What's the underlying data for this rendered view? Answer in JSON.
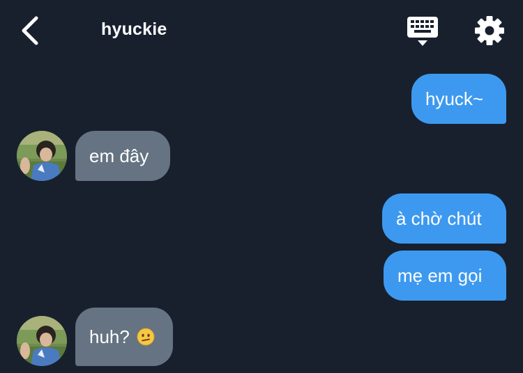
{
  "header": {
    "title": "hyuckie",
    "back_icon": "chevron-left-icon",
    "keyboard_icon": "keyboard-icon",
    "settings_icon": "gear-icon"
  },
  "messages": [
    {
      "direction": "outgoing",
      "text": "hyuck~"
    },
    {
      "direction": "incoming",
      "text": "em đây"
    },
    {
      "direction": "outgoing",
      "text": "à chờ chút"
    },
    {
      "direction": "outgoing",
      "text": "mẹ em gọi"
    },
    {
      "direction": "incoming",
      "text": "huh?",
      "emoji": "confused-face-icon"
    }
  ],
  "colors": {
    "background": "#18202e",
    "outgoing_bubble": "#3d99ef",
    "incoming_bubble": "#657382"
  }
}
